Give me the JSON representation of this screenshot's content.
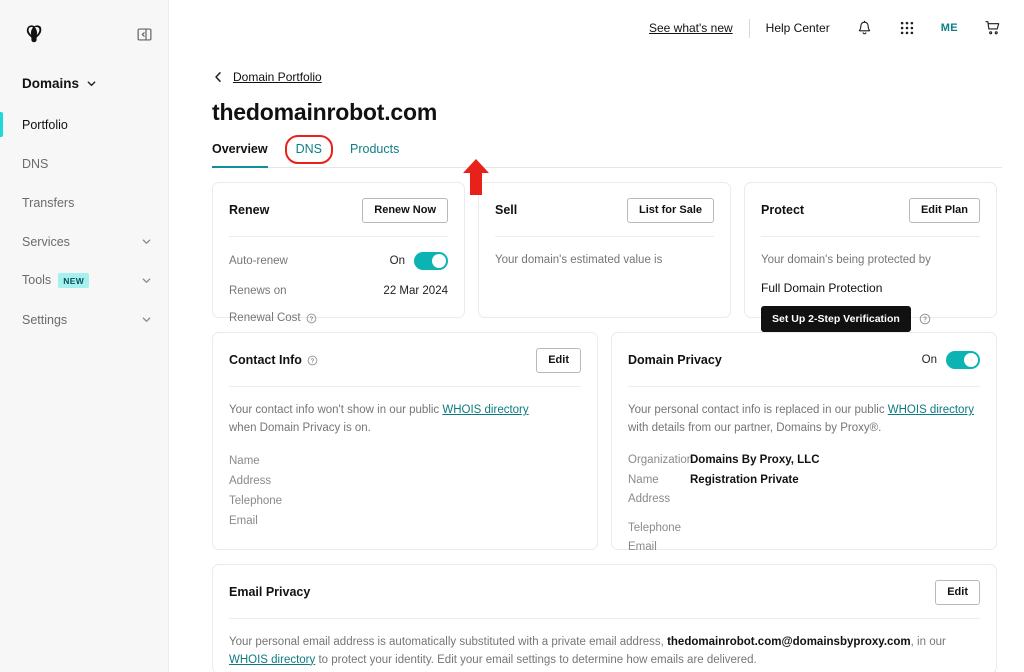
{
  "sidebar": {
    "logo_icon": "godaddy-logo-icon",
    "collapse_icon": "sidebar-collapse-icon",
    "section_label": "Domains",
    "items": [
      {
        "label": "Portfolio",
        "active": true,
        "has_chevron": false,
        "badge": ""
      },
      {
        "label": "DNS",
        "active": false,
        "has_chevron": false,
        "badge": ""
      },
      {
        "label": "Transfers",
        "active": false,
        "has_chevron": false,
        "badge": ""
      },
      {
        "label": "Services",
        "active": false,
        "has_chevron": true,
        "badge": ""
      },
      {
        "label": "Tools",
        "active": false,
        "has_chevron": true,
        "badge": "NEW"
      },
      {
        "label": "Settings",
        "active": false,
        "has_chevron": true,
        "badge": ""
      }
    ]
  },
  "topbar": {
    "whats_new": "See what's new",
    "help_center": "Help Center",
    "notifications_icon": "bell-icon",
    "apps_icon": "apps-grid-icon",
    "account_initials": "ME",
    "cart_icon": "cart-icon"
  },
  "breadcrumb": {
    "back_icon": "chevron-left-icon",
    "label": "Domain Portfolio"
  },
  "page": {
    "title": "thedomainrobot.com"
  },
  "tabs": [
    {
      "label": "Overview",
      "active": true,
      "highlighted": false
    },
    {
      "label": "DNS",
      "active": false,
      "highlighted": true
    },
    {
      "label": "Products",
      "active": false,
      "highlighted": false
    }
  ],
  "annotation": {
    "color": "#e8211a",
    "shape": "up-arrow-pointing-to-dns-tab"
  },
  "renew_card": {
    "title": "Renew",
    "button": "Renew Now",
    "auto_renew_label": "Auto-renew",
    "auto_renew_state": "On",
    "renews_on_label": "Renews on",
    "renews_on_value": "22 Mar 2024",
    "renewal_cost_label": "Renewal Cost",
    "renewal_cost_value": ""
  },
  "sell_card": {
    "title": "Sell",
    "button": "List for Sale",
    "body": "Your domain's estimated value is"
  },
  "protect_card": {
    "title": "Protect",
    "button": "Edit Plan",
    "body": "Your domain's being protected by",
    "plan": "Full Domain Protection",
    "cta": "Set Up 2-Step Verification"
  },
  "contact_info_card": {
    "title": "Contact Info",
    "button": "Edit",
    "body_before_link": "Your contact info won't show in our public ",
    "link_text": "WHOIS directory",
    "body_after_link": " when Domain Privacy is on.",
    "fields": [
      {
        "label": "Name",
        "value": ""
      },
      {
        "label": "Address",
        "value": ""
      },
      {
        "label": "Telephone",
        "value": ""
      },
      {
        "label": "Email",
        "value": ""
      }
    ]
  },
  "domain_privacy_card": {
    "title": "Domain Privacy",
    "toggle_state": "On",
    "body_before_link": "Your personal contact info is replaced in our public ",
    "link_text": "WHOIS directory",
    "body_after_link": " with details from our partner, Domains by Proxy®.",
    "fields": [
      {
        "label": "Organization",
        "value": "Domains By Proxy, LLC"
      },
      {
        "label": "Name",
        "value": "Registration Private"
      },
      {
        "label": "Address",
        "value": ""
      },
      {
        "label": "Telephone",
        "value": ""
      },
      {
        "label": "Email",
        "value": ""
      }
    ]
  },
  "email_privacy_card": {
    "title": "Email Privacy",
    "button": "Edit",
    "body_before_email": "Your personal email address is automatically substituted with a private email address, ",
    "email": "thedomainrobot.com@domainsbyproxy.com",
    "body_mid": ", in our ",
    "link_text": "WHOIS directory",
    "body_after_link": " to protect your identity. Edit your email settings to determine how emails are delivered."
  },
  "colors": {
    "accent_teal": "#0b7b80",
    "toggle_on": "#0bb3b3",
    "sidebar_active": "#1fd9d9",
    "badge_new_bg": "#a6f0f0",
    "annotation_red": "#e8211a"
  }
}
